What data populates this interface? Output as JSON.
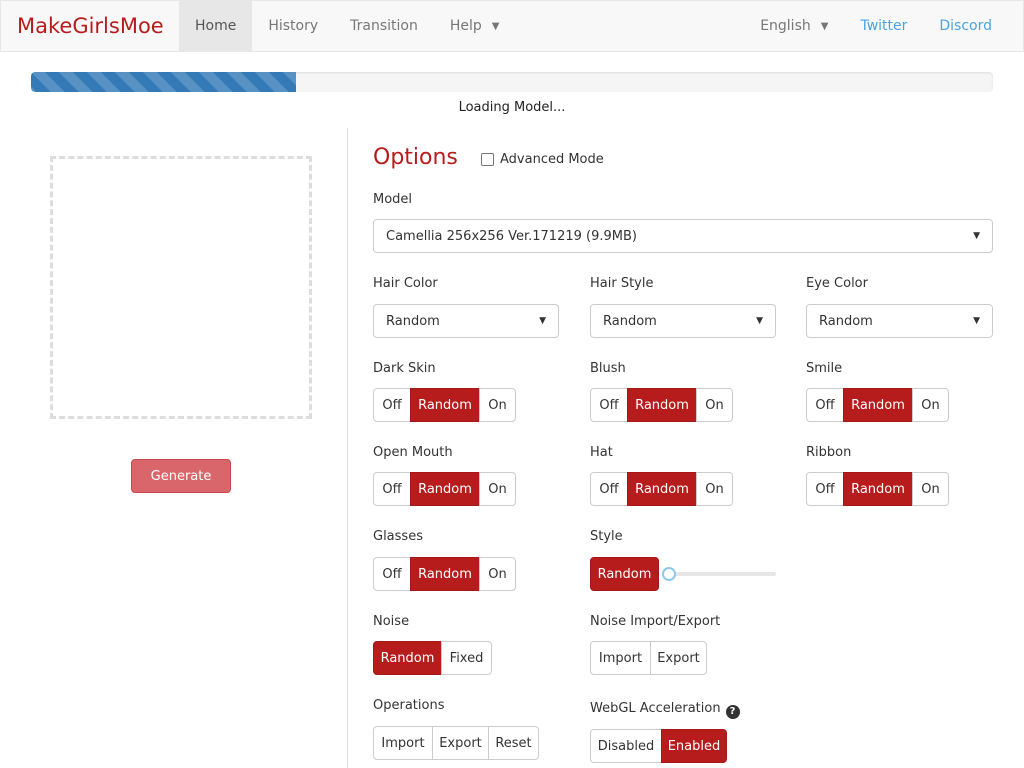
{
  "nav": {
    "brand": "MakeGirlsMoe",
    "items": [
      {
        "label": "Home"
      },
      {
        "label": "History"
      },
      {
        "label": "Transition"
      },
      {
        "label": "Help"
      }
    ],
    "language": "English",
    "twitter": "Twitter",
    "discord": "Discord"
  },
  "progress": {
    "percent": 27.5,
    "text": "Loading Model..."
  },
  "left": {
    "generate_label": "Generate"
  },
  "options": {
    "title": "Options",
    "advanced_mode": "Advanced Mode",
    "model": {
      "label": "Model",
      "value": "Camellia 256x256 Ver.171219 (9.9MB)"
    },
    "hair_color": {
      "label": "Hair Color",
      "value": "Random"
    },
    "hair_style": {
      "label": "Hair Style",
      "value": "Random"
    },
    "eye_color": {
      "label": "Eye Color",
      "value": "Random"
    },
    "dark_skin": {
      "label": "Dark Skin",
      "options": [
        "Off",
        "Random",
        "On"
      ],
      "selected": "Random"
    },
    "blush": {
      "label": "Blush",
      "options": [
        "Off",
        "Random",
        "On"
      ],
      "selected": "Random"
    },
    "smile": {
      "label": "Smile",
      "options": [
        "Off",
        "Random",
        "On"
      ],
      "selected": "Random"
    },
    "open_mouth": {
      "label": "Open Mouth",
      "options": [
        "Off",
        "Random",
        "On"
      ],
      "selected": "Random"
    },
    "hat": {
      "label": "Hat",
      "options": [
        "Off",
        "Random",
        "On"
      ],
      "selected": "Random"
    },
    "ribbon": {
      "label": "Ribbon",
      "options": [
        "Off",
        "Random",
        "On"
      ],
      "selected": "Random"
    },
    "glasses": {
      "label": "Glasses",
      "options": [
        "Off",
        "Random",
        "On"
      ],
      "selected": "Random"
    },
    "style": {
      "label": "Style",
      "button": "Random",
      "slider_value": 0
    },
    "noise": {
      "label": "Noise",
      "options": [
        "Random",
        "Fixed"
      ],
      "selected": "Random"
    },
    "noise_io": {
      "label": "Noise Import/Export",
      "options": [
        "Import",
        "Export"
      ]
    },
    "operations": {
      "label": "Operations",
      "options": [
        "Import",
        "Export",
        "Reset"
      ]
    },
    "webgl": {
      "label": "WebGL Acceleration",
      "options": [
        "Disabled",
        "Enabled"
      ],
      "selected": "Enabled"
    }
  },
  "colors": {
    "accent": "#b71c1c",
    "generate": "#d9666a",
    "progress": "#337ab7",
    "link": "#4aa3df"
  },
  "icons": {
    "help_dropdown": "caret-down-icon",
    "select_arrow": "caret-down-icon",
    "webgl_help": "question-circle-icon"
  }
}
